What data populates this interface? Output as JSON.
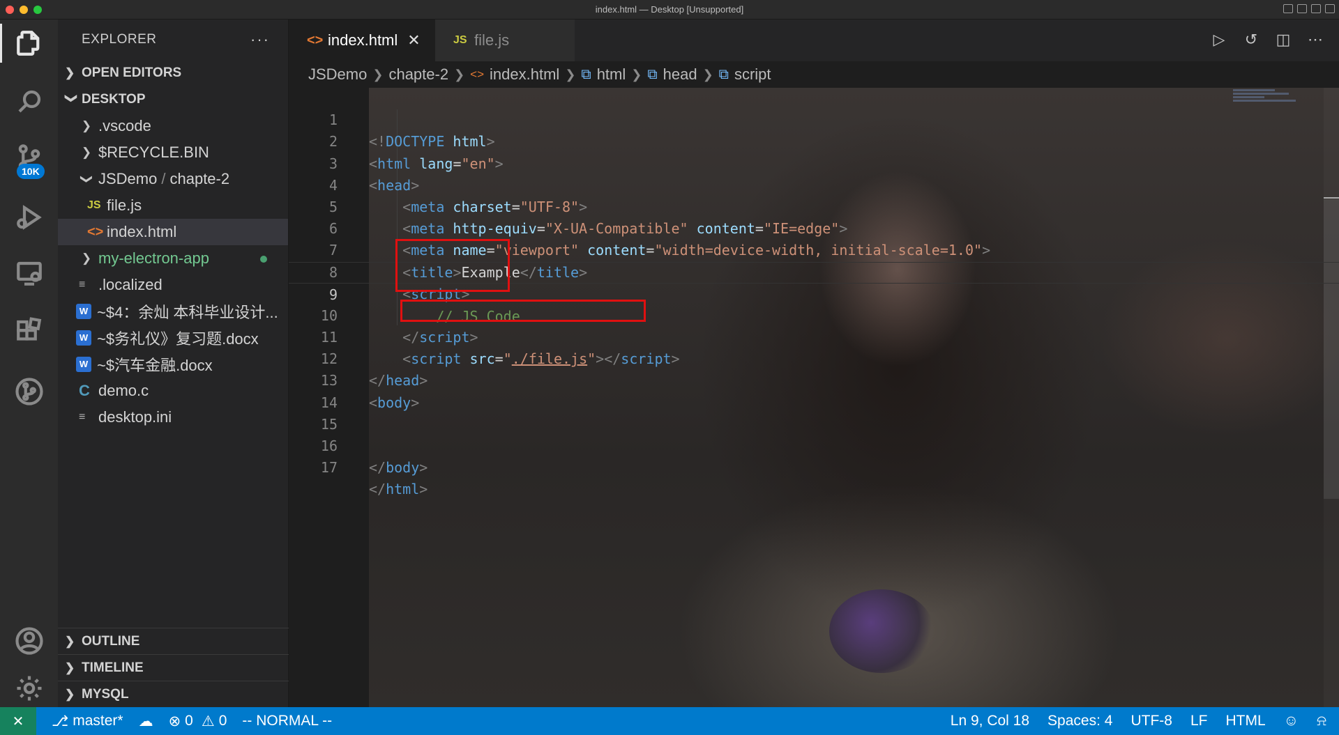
{
  "window": {
    "title": "index.html — Desktop [Unsupported]"
  },
  "activity_bar": {
    "items": [
      {
        "name": "explorer-icon",
        "active": true
      },
      {
        "name": "search-icon"
      },
      {
        "name": "source-control-icon",
        "badge": "10K"
      },
      {
        "name": "run-debug-icon"
      },
      {
        "name": "remote-explorer-icon"
      },
      {
        "name": "extensions-icon"
      },
      {
        "name": "git-graph-icon"
      }
    ],
    "bottom": [
      {
        "name": "account-icon"
      },
      {
        "name": "settings-gear-icon"
      }
    ]
  },
  "sidebar": {
    "title": "EXPLORER",
    "more": "···",
    "sections": {
      "open_editors": "OPEN EDITORS",
      "desktop": "DESKTOP",
      "outline": "OUTLINE",
      "timeline": "TIMELINE",
      "mysql": "MYSQL"
    },
    "tree": {
      "vscode": ".vscode",
      "recycle": "$RECYCLE.BIN",
      "jsdemo_a": "JSDemo",
      "jsdemo_sep": "/",
      "jsdemo_b": "chapte-2",
      "file_js": "file.js",
      "index_html": "index.html",
      "electron": "my-electron-app",
      "localized": ".localized",
      "doc1": "~$4：余灿 本科毕业设计...",
      "doc2": "~$务礼仪》复习题.docx",
      "doc3": "~$汽车金融.docx",
      "demo_c": "demo.c",
      "desktop_ini": "desktop.ini"
    },
    "icons": {
      "js": "JS",
      "html": "<>",
      "c": "C",
      "lines": "≡",
      "word": "W"
    }
  },
  "tabs": [
    {
      "label": "index.html",
      "icon": "<>",
      "active": true,
      "close": "✕"
    },
    {
      "label": "file.js",
      "icon": "JS",
      "active": false
    }
  ],
  "editor_actions": [
    "run-icon",
    "timeline-history-icon",
    "split-editor-icon",
    "more-actions-icon"
  ],
  "breadcrumb": {
    "a": "JSDemo",
    "b": "chapte-2",
    "c": "index.html",
    "d": "html",
    "e": "head",
    "f": "script"
  },
  "code": {
    "line_numbers": [
      "1",
      "2",
      "3",
      "4",
      "5",
      "6",
      "7",
      "8",
      "9",
      "10",
      "11",
      "12",
      "13",
      "14",
      "15",
      "16",
      "17"
    ],
    "l1": {
      "open": "<!",
      "tag": "DOCTYPE",
      "attr": " html",
      "close": ">"
    },
    "l2": {
      "open": "<",
      "tag": "html",
      "attr": " lang",
      "eq": "=",
      "val": "\"en\"",
      "close": ">"
    },
    "l3": {
      "open": "<",
      "tag": "head",
      "close": ">"
    },
    "l4": {
      "indent": "    ",
      "open": "<",
      "tag": "meta",
      "attr": " charset",
      "eq": "=",
      "val": "\"UTF-8\"",
      "close": ">"
    },
    "l5": {
      "indent": "    ",
      "open": "<",
      "tag": "meta",
      "attr1": " http-equiv",
      "eq": "=",
      "val1": "\"X-UA-Compatible\"",
      "attr2": " content",
      "val2": "\"IE=edge\"",
      "close": ">"
    },
    "l6": {
      "indent": "    ",
      "open": "<",
      "tag": "meta",
      "attr1": " name",
      "eq": "=",
      "val1": "\"viewport\"",
      "attr2": " content",
      "val2": "\"width=device-width, initial-scale=1.0\"",
      "close": ">"
    },
    "l7": {
      "indent": "    ",
      "open": "<",
      "tag": "title",
      "close": ">",
      "text": "Example",
      "open2": "</",
      "tag2": "title",
      "close2": ">"
    },
    "l8": {
      "indent": "    ",
      "open": "<",
      "tag": "script",
      "close": ">"
    },
    "l9": {
      "indent": "        ",
      "comment": "// JS Code"
    },
    "l10": {
      "indent": "    ",
      "open": "</",
      "tag": "script",
      "close": ">"
    },
    "l11": {
      "indent": "    ",
      "open": "<",
      "tag": "script",
      "attr": " src",
      "eq": "=",
      "q1": "\"",
      "link": "./file.js",
      "q2": "\"",
      "close": ">",
      "open2": "</",
      "tag2": "script",
      "close2": ">"
    },
    "l12": {
      "open": "</",
      "tag": "head",
      "close": ">"
    },
    "l13": {
      "open": "<",
      "tag": "body",
      "close": ">"
    },
    "l16": {
      "open": "</",
      "tag": "body",
      "close": ">"
    },
    "l17": {
      "open": "</",
      "tag": "html",
      "close": ">"
    }
  },
  "status_bar": {
    "branch": "master*",
    "errors": "0",
    "warnings": "0",
    "mode": "-- NORMAL --",
    "position": "Ln 9, Col 18",
    "spaces": "Spaces: 4",
    "encoding": "UTF-8",
    "eol": "LF",
    "language": "HTML"
  },
  "colors": {
    "status_bar": "#007acc",
    "remote_indicator": "#16825d",
    "highlight_box": "#e01010",
    "badge": "#0078d4"
  }
}
